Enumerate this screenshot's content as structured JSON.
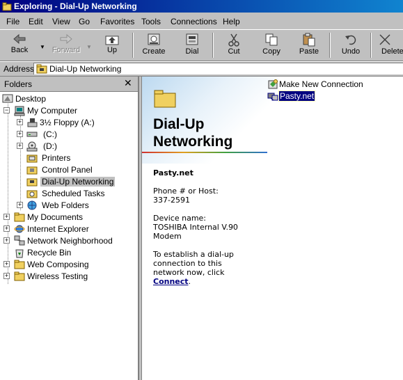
{
  "window": {
    "title": "Exploring - Dial-Up Networking"
  },
  "menu": [
    "File",
    "Edit",
    "View",
    "Go",
    "Favorites",
    "Tools",
    "Connections",
    "Help"
  ],
  "toolbar": {
    "back": "Back",
    "forward": "Forward",
    "up": "Up",
    "create": "Create",
    "dial": "Dial",
    "cut": "Cut",
    "copy": "Copy",
    "paste": "Paste",
    "undo": "Undo",
    "delete": "Delete"
  },
  "address": {
    "label": "Address",
    "value": "Dial-Up Networking"
  },
  "folders": {
    "title": "Folders",
    "close": "✕",
    "tree": [
      {
        "label": "Desktop",
        "icon": "desktop-icon"
      },
      {
        "label": "My Computer",
        "icon": "computer-icon",
        "expanded": true
      },
      {
        "label": "3½ Floppy (A:)",
        "icon": "floppy-icon"
      },
      {
        "label": "(C:)",
        "icon": "hard-drive-icon"
      },
      {
        "label": "(D:)",
        "icon": "cd-drive-icon"
      },
      {
        "label": "Printers",
        "icon": "printer-folder-icon"
      },
      {
        "label": "Control Panel",
        "icon": "control-panel-icon"
      },
      {
        "label": "Dial-Up Networking",
        "icon": "dialup-folder-icon",
        "selected": true
      },
      {
        "label": "Scheduled Tasks",
        "icon": "scheduled-tasks-icon"
      },
      {
        "label": "Web Folders",
        "icon": "web-folder-icon"
      },
      {
        "label": "My Documents",
        "icon": "folder-icon"
      },
      {
        "label": "Internet Explorer",
        "icon": "internet-explorer-icon"
      },
      {
        "label": "Network Neighborhood",
        "icon": "network-icon"
      },
      {
        "label": "Recycle Bin",
        "icon": "recycle-bin-icon"
      },
      {
        "label": "Web Composing",
        "icon": "folder-icon"
      },
      {
        "label": "Wireless Testing",
        "icon": "folder-icon"
      }
    ]
  },
  "content": {
    "heading_line1": "Dial-Up",
    "heading_line2": "Networking",
    "selected_name": "Pasty.net",
    "phone_label": "Phone # or Host:",
    "phone_value": "337-2591",
    "device_label": "Device name:",
    "device_value_1": "TOSHIBA Internal V.90",
    "device_value_2": "Modem",
    "hint_1": "To establish a dial-up",
    "hint_2": "connection to this",
    "hint_3": "network now, click",
    "hint_link": "Connect",
    "hint_end": ".",
    "items": [
      "Make New Connection",
      "Pasty.net"
    ]
  }
}
